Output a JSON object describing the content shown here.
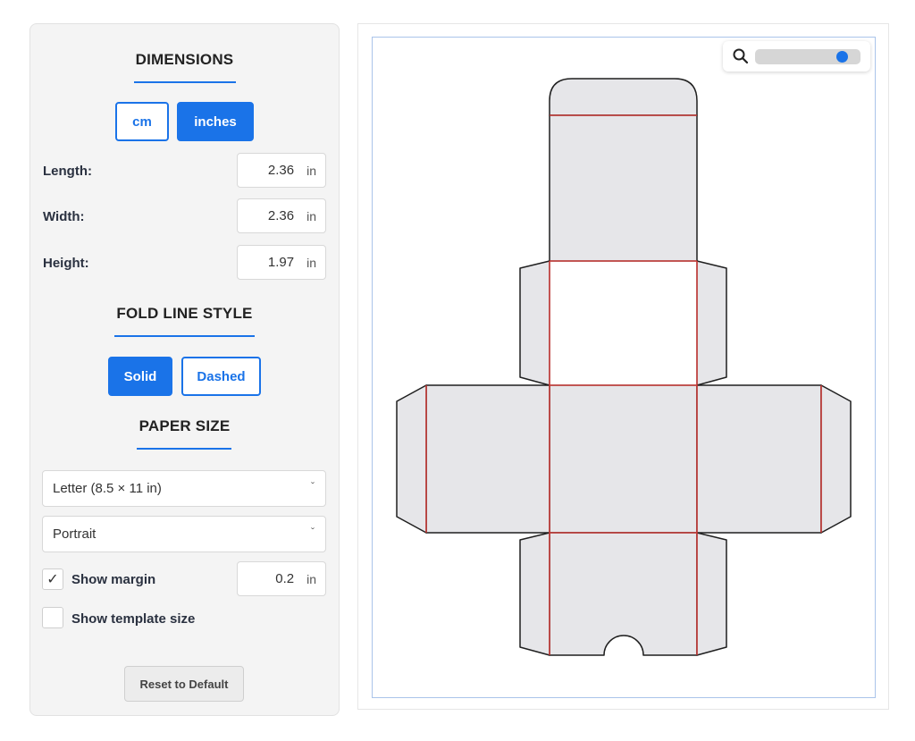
{
  "sidebar": {
    "dimensions_title": "DIMENSIONS",
    "units": {
      "cm_label": "cm",
      "inches_label": "inches",
      "selected": "inches"
    },
    "length": {
      "label": "Length:",
      "value": "2.36",
      "unit": "in"
    },
    "width": {
      "label": "Width:",
      "value": "2.36",
      "unit": "in"
    },
    "height": {
      "label": "Height:",
      "value": "1.97",
      "unit": "in"
    },
    "fold_title": "FOLD LINE STYLE",
    "fold": {
      "solid_label": "Solid",
      "dashed_label": "Dashed",
      "selected": "Solid"
    },
    "paper_title": "PAPER SIZE",
    "paper_size": {
      "value": "Letter (8.5 × 11 in)",
      "chevron": "ˇ"
    },
    "orientation": {
      "value": "Portrait",
      "chevron": "ˇ"
    },
    "show_margin": {
      "label": "Show margin",
      "checked": true,
      "check_glyph": "✓",
      "value": "0.2",
      "unit": "in"
    },
    "show_template_size": {
      "label": "Show template size",
      "checked": false
    },
    "reset_label": "Reset to Default"
  },
  "preview": {
    "zoom_level": 0.88,
    "icons": {
      "zoom": "search-icon"
    },
    "colors": {
      "panel_fill": "#e6e6e9",
      "cut_line": "#1f1f1f",
      "fold_line": "#e53935",
      "accent": "#1a73e8"
    }
  }
}
